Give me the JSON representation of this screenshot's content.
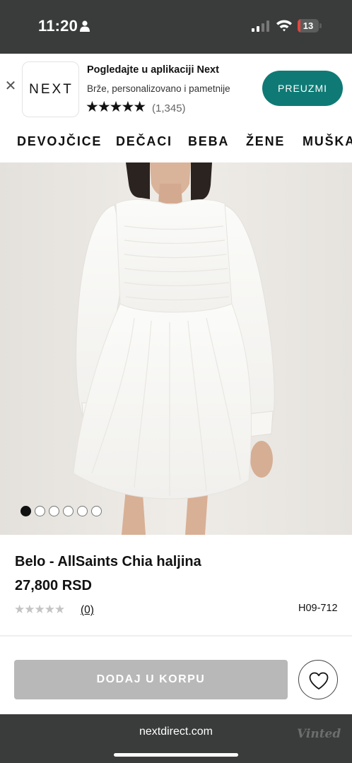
{
  "status_bar": {
    "time": "11:20",
    "battery_level": "13",
    "battery_fraction": 0.13,
    "icons": [
      "person-icon",
      "signal-icon",
      "wifi-icon",
      "battery-icon"
    ]
  },
  "app_banner": {
    "close_symbol": "✕",
    "logo_text": "NEXT",
    "title": "Pogledajte u aplikaciji Next",
    "subtitle": "Brže, personalizovano i pametnije",
    "stars": "★★★★★",
    "rating_count": "(1,345)",
    "install_label": "PREUZMI",
    "accent_color": "#0f7a75"
  },
  "categories": [
    {
      "label": "DEVOJČICE"
    },
    {
      "label": "DEČACI"
    },
    {
      "label": "BEBA"
    },
    {
      "label": "ŽENE"
    },
    {
      "label": "MUŠKARCI"
    }
  ],
  "gallery": {
    "image": "white-dress-photo",
    "slide_count": 6,
    "active_slide": 1
  },
  "product": {
    "name": "Belo - AllSaints Chia haljina",
    "price": "27,800 RSD",
    "rating_stars": "★★★★★",
    "rating_value": 0,
    "review_count": "(0)",
    "code": "H09-712",
    "add_to_bag_label": "DODAJ U KORPU",
    "favourite_icon": "heart-icon"
  },
  "browser": {
    "url": "nextdirect.com",
    "watermark": "Vinted"
  }
}
